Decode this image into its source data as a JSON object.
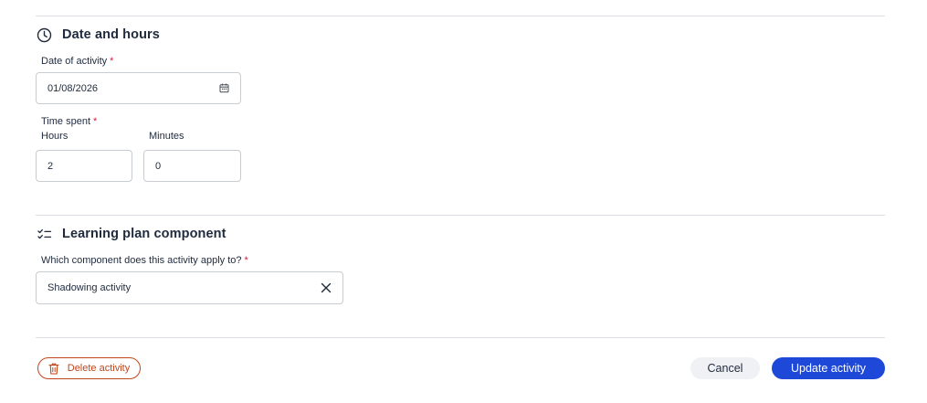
{
  "date_section": {
    "icon": "clock-icon",
    "title": "Date and hours",
    "date_label": "Date of activity",
    "date_value": "01/08/2026",
    "time_label": "Time spent",
    "hours_label": "Hours",
    "hours_value": "2",
    "minutes_label": "Minutes",
    "minutes_value": "0",
    "required_mark": "*"
  },
  "component_section": {
    "icon": "checklist-icon",
    "title": "Learning plan component",
    "question_label": "Which component does this activity apply to?",
    "selected_value": "Shadowing activity",
    "required_mark": "*"
  },
  "footer": {
    "delete_label": "Delete activity",
    "cancel_label": "Cancel",
    "update_label": "Update activity"
  },
  "colors": {
    "primary": "#1e48d8",
    "danger": "#c0461c",
    "required": "#d81b3c",
    "border": "#c8ccd3"
  }
}
